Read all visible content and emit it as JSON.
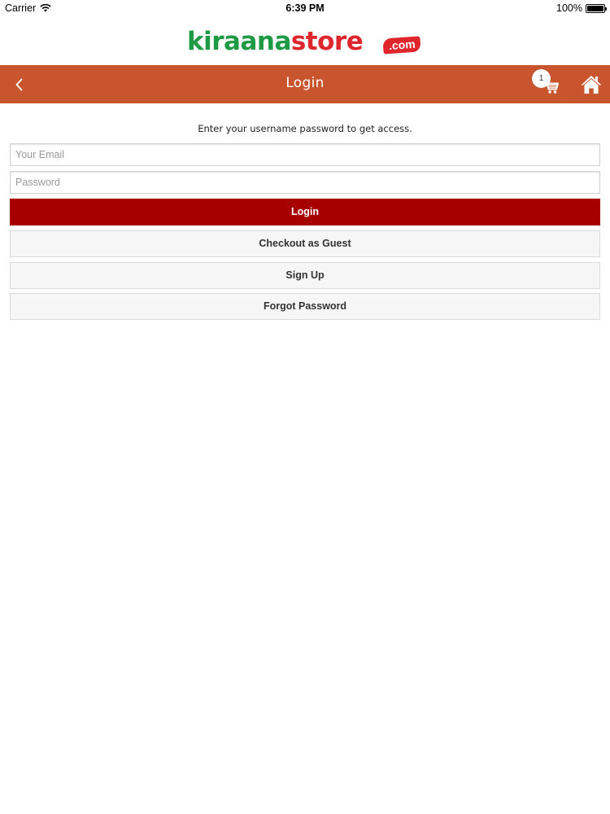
{
  "status_bar": {
    "carrier": "Carrier",
    "time": "6:39 PM",
    "battery": "100%"
  },
  "logo": {
    "part_green": "kiraana",
    "part_red": "store",
    "badge": ".com"
  },
  "nav": {
    "title": "Login",
    "back_icon": "chevron-left-icon",
    "cart_icon": "cart-icon",
    "cart_count": "1",
    "home_icon": "home-icon"
  },
  "form": {
    "instruction": "Enter your username password to get access.",
    "email_placeholder": "Your Email",
    "email_value": "",
    "password_placeholder": "Password",
    "password_value": ""
  },
  "buttons": {
    "login": "Login",
    "guest": "Checkout as Guest",
    "signup": "Sign Up",
    "forgot": "Forgot Password"
  },
  "colors": {
    "nav_bar": "#c8552d",
    "login_button": "#a70000",
    "logo_green": "#1e9a45",
    "logo_red": "#e0262d"
  }
}
